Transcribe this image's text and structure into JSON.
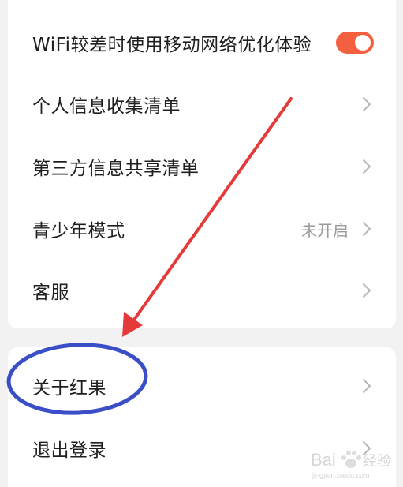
{
  "colors": {
    "toggle_on": "#f4603f",
    "chevron": "#b8b8b8",
    "annotation_arrow": "#e53a3a",
    "annotation_ellipse": "#3a4fc7"
  },
  "settings_group_1": {
    "items": [
      {
        "label": "WiFi较差时使用移动网络优化体验",
        "control": "toggle",
        "toggle_on": true
      },
      {
        "label": "个人信息收集清单",
        "control": "chevron-right-icon"
      },
      {
        "label": "第三方信息共享清单",
        "control": "chevron-right-icon"
      },
      {
        "label": "青少年模式",
        "value": "未开启",
        "control": "chevron-right-icon"
      },
      {
        "label": "客服",
        "control": "chevron-right-icon"
      }
    ]
  },
  "settings_group_2": {
    "items": [
      {
        "label": "关于红果",
        "control": "chevron-right-icon"
      },
      {
        "label": "退出登录",
        "control": "chevron-right-icon"
      }
    ]
  },
  "watermark": {
    "text": "Bai 经验",
    "sub": "jingyan.baidu.com"
  }
}
